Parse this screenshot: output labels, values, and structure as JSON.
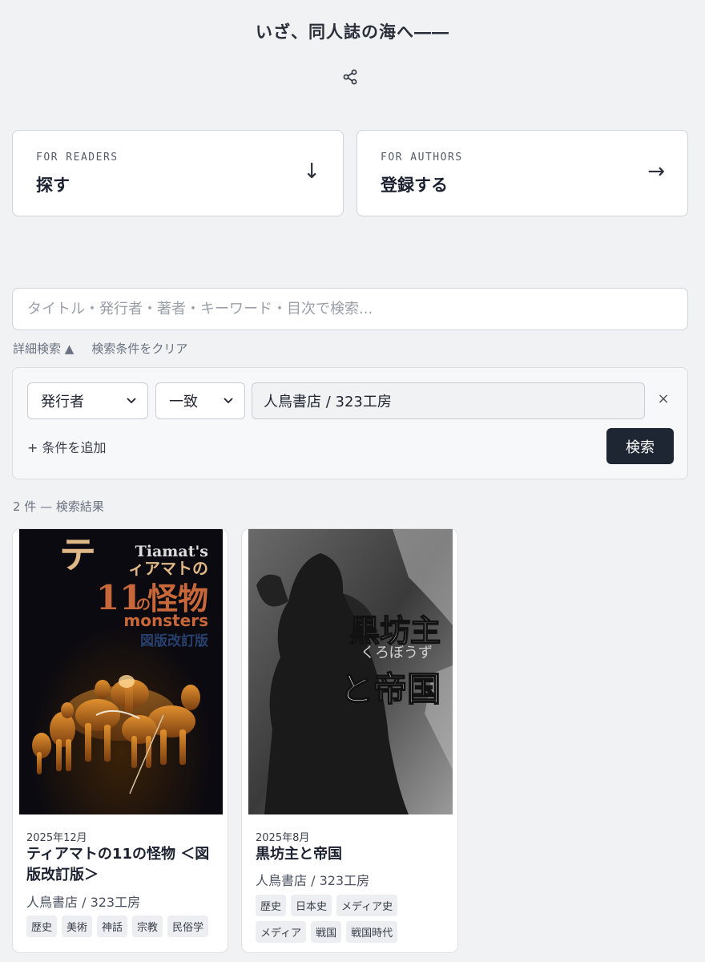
{
  "header": {
    "site_title": "いざ、同人誌の海へ――",
    "share_icon": "share-icon"
  },
  "nav_cards": [
    {
      "kicker": "FOR READERS",
      "label": "探す",
      "arrow": "↓"
    },
    {
      "kicker": "FOR AUTHORS",
      "label": "登録する",
      "arrow": "→"
    }
  ],
  "search": {
    "placeholder": "タイトル・発行者・著者・キーワード・目次で検索...",
    "advanced_toggle": "詳細検索 ▲",
    "clear_link": "検索条件をクリア"
  },
  "filter": {
    "field_selected": "発行者",
    "match_selected": "一致",
    "value": "人鳥書店 / 323工房",
    "remove_label": "×",
    "add_condition": "+ 条件を追加",
    "search_button": "検索"
  },
  "results": {
    "count_text": "2 件 — 検索結果",
    "books": [
      {
        "date": "2025年12月",
        "title": "ティアマトの11の怪物 ＜図版改訂版＞",
        "publisher": "人鳥書店 / 323工房",
        "tags": [
          "歴史",
          "美術",
          "神話",
          "宗教",
          "民俗学"
        ],
        "cover": {
          "line_ti": "テ",
          "line_latin": "Tiamat's",
          "line_kana": "ィアマトの",
          "line_num": "11",
          "line_no": "の",
          "line_kaibutsu": "怪物",
          "line_monsters": "monsters",
          "line_edition": "図版改訂版"
        }
      },
      {
        "date": "2025年8月",
        "title": "黒坊主と帝国",
        "publisher": "人鳥書店 / 323工房",
        "tags": [
          "歴史",
          "日本史",
          "メディア史",
          "メディア",
          "戦国",
          "戦国時代"
        ],
        "cover": {
          "line_main": "黒坊主",
          "line_ruby": "くろぼうず",
          "line_sub": "と帝国"
        }
      }
    ]
  }
}
